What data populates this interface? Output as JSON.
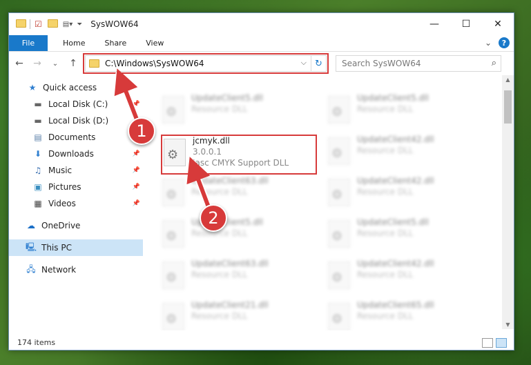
{
  "window": {
    "title": "SysWOW64",
    "controls": {
      "minimize": "—",
      "maximize": "☐",
      "close": "✕"
    }
  },
  "ribbon": {
    "tabs": [
      "File",
      "Home",
      "Share",
      "View"
    ],
    "expand": "⌄",
    "help": "?"
  },
  "nav": {
    "back": "←",
    "forward": "→",
    "recent": "⌄",
    "up": "↑",
    "address": "C:\\Windows\\SysWOW64",
    "search_placeholder": "Search SysWOW64"
  },
  "sidebar": {
    "items": [
      {
        "label": "Quick access",
        "icon": "star-icon"
      },
      {
        "label": "Local Disk (C:)",
        "icon": "drive-icon"
      },
      {
        "label": "Local Disk (D:)",
        "icon": "drive-icon"
      },
      {
        "label": "Documents",
        "icon": "documents-icon"
      },
      {
        "label": "Downloads",
        "icon": "download-icon"
      },
      {
        "label": "Music",
        "icon": "music-icon"
      },
      {
        "label": "Pictures",
        "icon": "pictures-icon"
      },
      {
        "label": "Videos",
        "icon": "videos-icon"
      },
      {
        "label": "OneDrive",
        "icon": "cloud-icon"
      },
      {
        "label": "This PC",
        "icon": "computer-icon"
      },
      {
        "label": "Network",
        "icon": "network-icon"
      }
    ]
  },
  "files": {
    "highlighted": {
      "name": "jcmyk.dll",
      "version": "3.0.0.1",
      "description": "Jasc CMYK Support DLL"
    },
    "background": [
      {
        "name": "UpdateClient5.dll",
        "type": "Resource DLL"
      },
      {
        "name": "UpdateClient5.dll",
        "type": "Resource DLL"
      },
      {
        "name": "UpdateClient42.dll",
        "type": "Resource DLL"
      },
      {
        "name": "UpdateClient63.dll",
        "type": "Resource DLL"
      },
      {
        "name": "UpdateClient42.dll",
        "type": "Resource DLL"
      },
      {
        "name": "UpdateClient5.dll",
        "type": "Resource DLL"
      },
      {
        "name": "UpdateClient5.dll",
        "type": "Resource DLL"
      },
      {
        "name": "UpdateClient63.dll",
        "type": "Resource DLL"
      },
      {
        "name": "UpdateClient42.dll",
        "type": "Resource DLL"
      },
      {
        "name": "UpdateClient21.dll",
        "type": "Resource DLL"
      },
      {
        "name": "UpdateClient65.dll",
        "type": "Resource DLL"
      }
    ]
  },
  "status": {
    "count": "174 items"
  },
  "annotations": {
    "step1": "1",
    "step2": "2"
  },
  "colors": {
    "accent": "#1979ca",
    "highlight": "#d73a3a",
    "selected": "#cce4f7"
  }
}
